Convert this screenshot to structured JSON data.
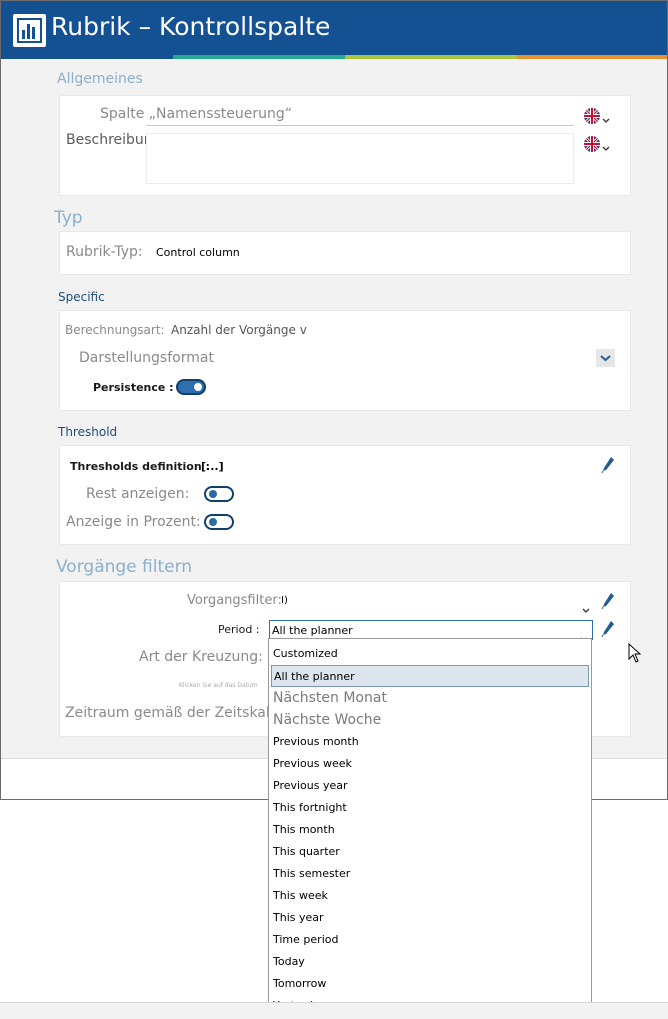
{
  "window": {
    "title": "Rubrik – Kontrollspalte",
    "stripe_colors": [
      "#135193",
      "#27a98e",
      "#a9c53a",
      "#e9912f"
    ]
  },
  "general": {
    "heading": "Allgemeines",
    "column_name_placeholder": "Spalte „Namenssteuerung“",
    "description_label": "Beschreibung:"
  },
  "type": {
    "heading": "Typ",
    "label": "Rubrik-Typ:",
    "value": "Control column"
  },
  "specific": {
    "heading": "Specific",
    "calc_label": "Berechnungsart:",
    "calc_value": "Anzahl der Vorgänge v",
    "display_format_label": "Darstellungsformat",
    "persistence_label": "Persistence :",
    "persistence_on": true
  },
  "threshold": {
    "heading": "Threshold",
    "definition_label": "Thresholds definition :",
    "definition_value": "[...]",
    "show_rest_label": "Rest anzeigen:",
    "show_rest_on": false,
    "percent_label": "Anzeige in Prozent:",
    "percent_on": false
  },
  "filter": {
    "heading": "Vorgänge filtern",
    "filter_label": "Vorgangsfilter:",
    "filter_value": "I)",
    "period_label": "Period :",
    "period_value": "All the planner",
    "crossing_label": "Art der Kreuzung:",
    "hint_text": "Klicken Sie auf das Datum",
    "timescale_label": "Zeitraum gemäß der Zeitskala"
  },
  "period_dropdown": {
    "items": [
      "Customized",
      "All the planner",
      "Nächsten Monat",
      "Nächste Woche",
      "Previous month",
      "Previous week",
      "Previous year",
      "This fortnight",
      "This month",
      "This quarter",
      "This semester",
      "This week",
      "This year",
      "Time period",
      "Today",
      "Tomorrow",
      "Yesterday"
    ],
    "selected_index": 1
  },
  "icons": {
    "app": "chart-logo-icon",
    "flag": "uk-flag-icon",
    "chevron": "chevron-down-icon",
    "edit": "pencil-icon",
    "cursor": "mouse-cursor-icon"
  }
}
